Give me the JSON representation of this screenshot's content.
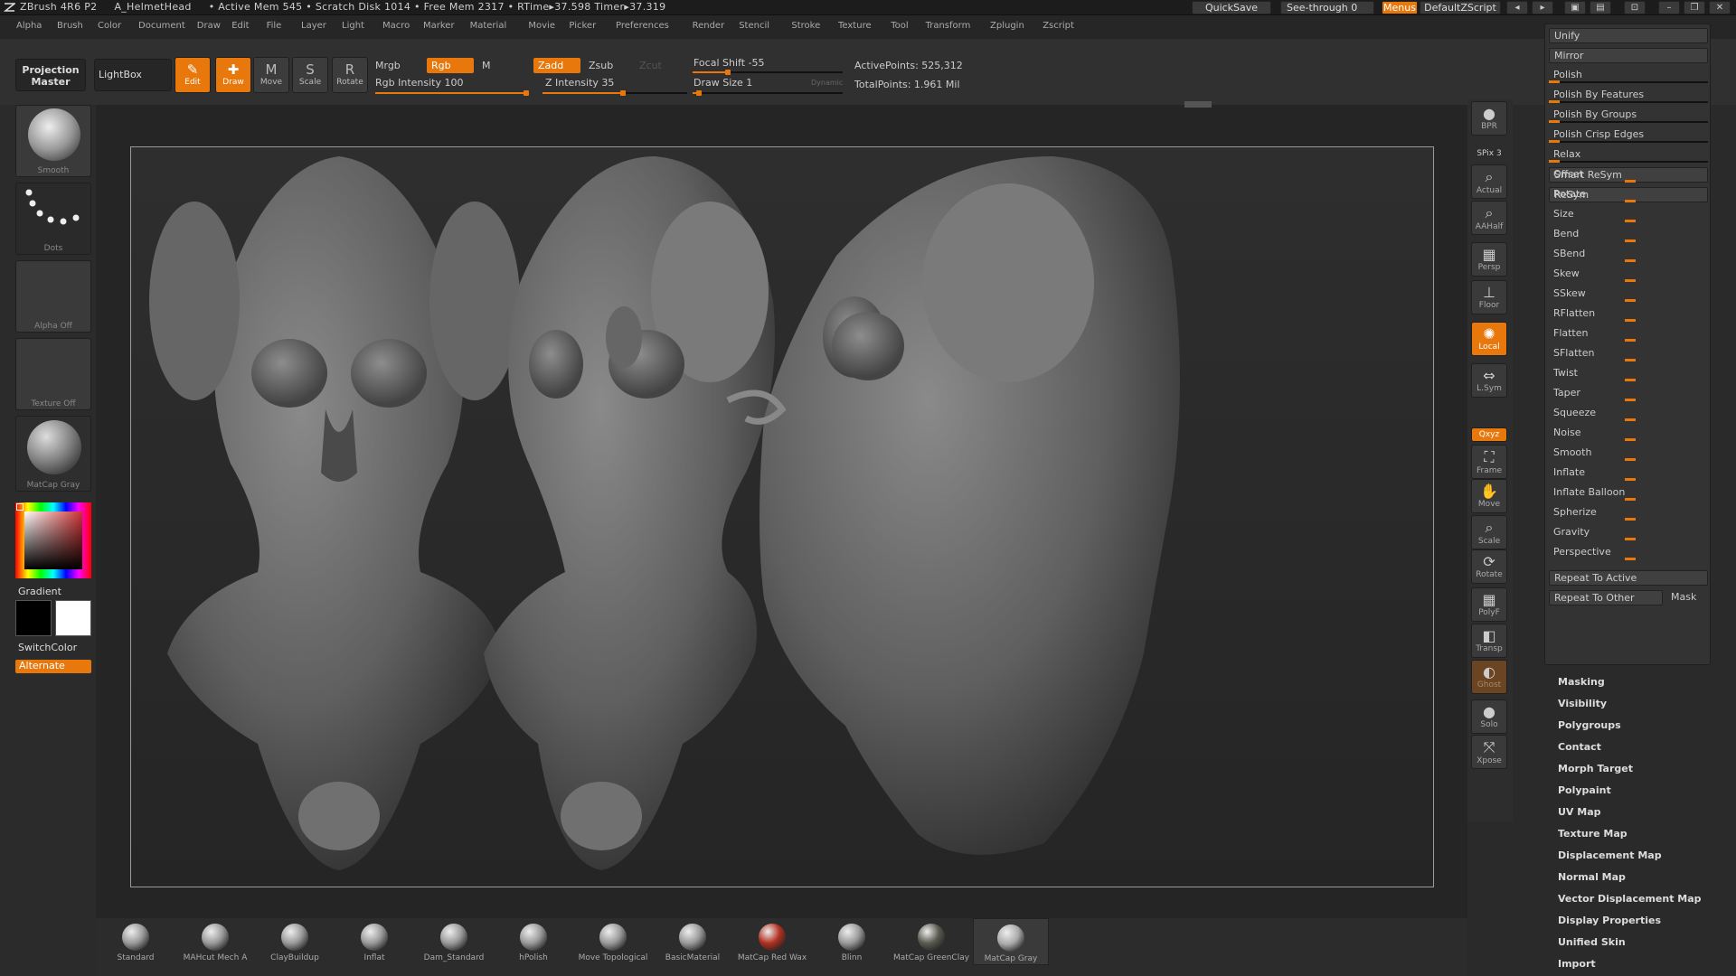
{
  "titlebar": {
    "app": "ZBrush 4R6 P2",
    "doc": "A_HelmetHead",
    "mem": "• Active Mem 545 • Scratch Disk 1014 • Free Mem 2317 • RTime▸37.598 Timer▸37.319",
    "quicksave": "QuickSave",
    "seethrough": "See-through  0",
    "menus": "Menus",
    "script": "DefaultZScript"
  },
  "menubar": [
    "Alpha",
    "Brush",
    "Color",
    "Document",
    "Draw",
    "Edit",
    "File",
    "Layer",
    "Light",
    "Macro",
    "Marker",
    "Material",
    "Movie",
    "Picker",
    "Preferences",
    "Render",
    "Stencil",
    "Stroke",
    "Texture",
    "Tool",
    "Transform",
    "Zplugin",
    "Zscript"
  ],
  "toolbar": {
    "projection": "Projection Master",
    "lightbox": "LightBox",
    "tools": [
      {
        "label": "Edit",
        "on": true,
        "icon": "✎"
      },
      {
        "label": "Draw",
        "on": true,
        "icon": "✚"
      },
      {
        "label": "Move",
        "on": false,
        "icon": "M"
      },
      {
        "label": "Scale",
        "on": false,
        "icon": "S"
      },
      {
        "label": "Rotate",
        "on": false,
        "icon": "R"
      }
    ],
    "mrgb": "Mrgb",
    "rgb": "Rgb",
    "m": "M",
    "zadd": "Zadd",
    "zsub": "Zsub",
    "zcut": "Zcut",
    "rgb_intensity": "Rgb Intensity 100",
    "z_intensity": "Z Intensity 35",
    "focal_shift": "Focal Shift -55",
    "draw_size": "Draw Size 1",
    "dynamic": "Dynamic",
    "active_points": "ActivePoints: 525,312",
    "total_points": "TotalPoints: 1.961 Mil"
  },
  "leftshelf": {
    "brush": "Smooth",
    "stroke": "Dots",
    "alpha": "Alpha Off",
    "texture": "Texture Off",
    "material": "MatCap Gray",
    "gradient": "Gradient",
    "switchcolor": "SwitchColor",
    "alternate": "Alternate"
  },
  "righttools": [
    {
      "label": "BPR",
      "icon": "●"
    },
    {
      "label": "SPix 3",
      "icon": ""
    },
    {
      "label": "Actual",
      "icon": "⌕"
    },
    {
      "label": "AAHalf",
      "icon": "⌕"
    },
    {
      "label": "Persp",
      "icon": "▦"
    },
    {
      "label": "Floor",
      "icon": "⊥"
    },
    {
      "label": "Local",
      "icon": "✺"
    },
    {
      "label": "L.Sym",
      "icon": "⇔"
    },
    {
      "label": "Qxyz",
      "icon": ""
    },
    {
      "label": "Frame",
      "icon": "⛶"
    },
    {
      "label": "Move",
      "icon": "✋"
    },
    {
      "label": "Scale",
      "icon": "⌕"
    },
    {
      "label": "Rotate",
      "icon": "⟳"
    },
    {
      "label": "PolyF",
      "icon": "▦"
    },
    {
      "label": "Transp",
      "icon": "◧"
    },
    {
      "label": "Ghost",
      "icon": "◐"
    },
    {
      "label": "Solo",
      "icon": "●"
    },
    {
      "label": "Xpose",
      "icon": "⤧"
    }
  ],
  "rightpanel": {
    "header": [
      "Unify",
      "Mirror",
      "Polish",
      "Polish By Features",
      "Polish By Groups",
      "Polish Crisp Edges",
      "Relax",
      "Smart ReSym",
      "ReSym"
    ],
    "sliders": [
      "Offset",
      "Rotate",
      "Size",
      "Bend",
      "SBend",
      "Skew",
      "SSkew",
      "RFlatten",
      "Flatten",
      "SFlatten",
      "Twist",
      "Taper",
      "Squeeze",
      "Noise",
      "Smooth",
      "Inflate",
      "Inflate Balloon",
      "Spherize",
      "Gravity",
      "Perspective"
    ],
    "repeat_active": "Repeat To Active",
    "repeat_other": "Repeat To Other",
    "mask": "Mask"
  },
  "rightmenu": [
    "Masking",
    "Visibility",
    "Polygroups",
    "Contact",
    "Morph Target",
    "Polypaint",
    "UV Map",
    "Texture Map",
    "Displacement Map",
    "Normal Map",
    "Vector Displacement Map",
    "Display Properties",
    "Unified Skin",
    "Import"
  ],
  "bottomshelf": [
    {
      "label": "Standard",
      "color": "#9a9a9a"
    },
    {
      "label": "MAHcut Mech A",
      "color": "#9a9a9a"
    },
    {
      "label": "ClayBuildup",
      "color": "#9a9a9a"
    },
    {
      "label": "Inflat",
      "color": "#9a9a9a"
    },
    {
      "label": "Dam_Standard",
      "color": "#9a9a9a"
    },
    {
      "label": "hPolish",
      "color": "#9a9a9a"
    },
    {
      "label": "Move Topological",
      "color": "#9a9a9a"
    },
    {
      "label": "BasicMaterial",
      "color": "#9a9a9a"
    },
    {
      "label": "MatCap Red Wax",
      "color": "#b03020"
    },
    {
      "label": "Blinn",
      "color": "#9a9a9a"
    },
    {
      "label": "MatCap GreenClay",
      "color": "#5a5a50"
    },
    {
      "label": "MatCap Gray",
      "color": "#aaaaaa"
    }
  ],
  "colors": {
    "accent": "#e8780b",
    "bg": "#2a2a2a"
  }
}
